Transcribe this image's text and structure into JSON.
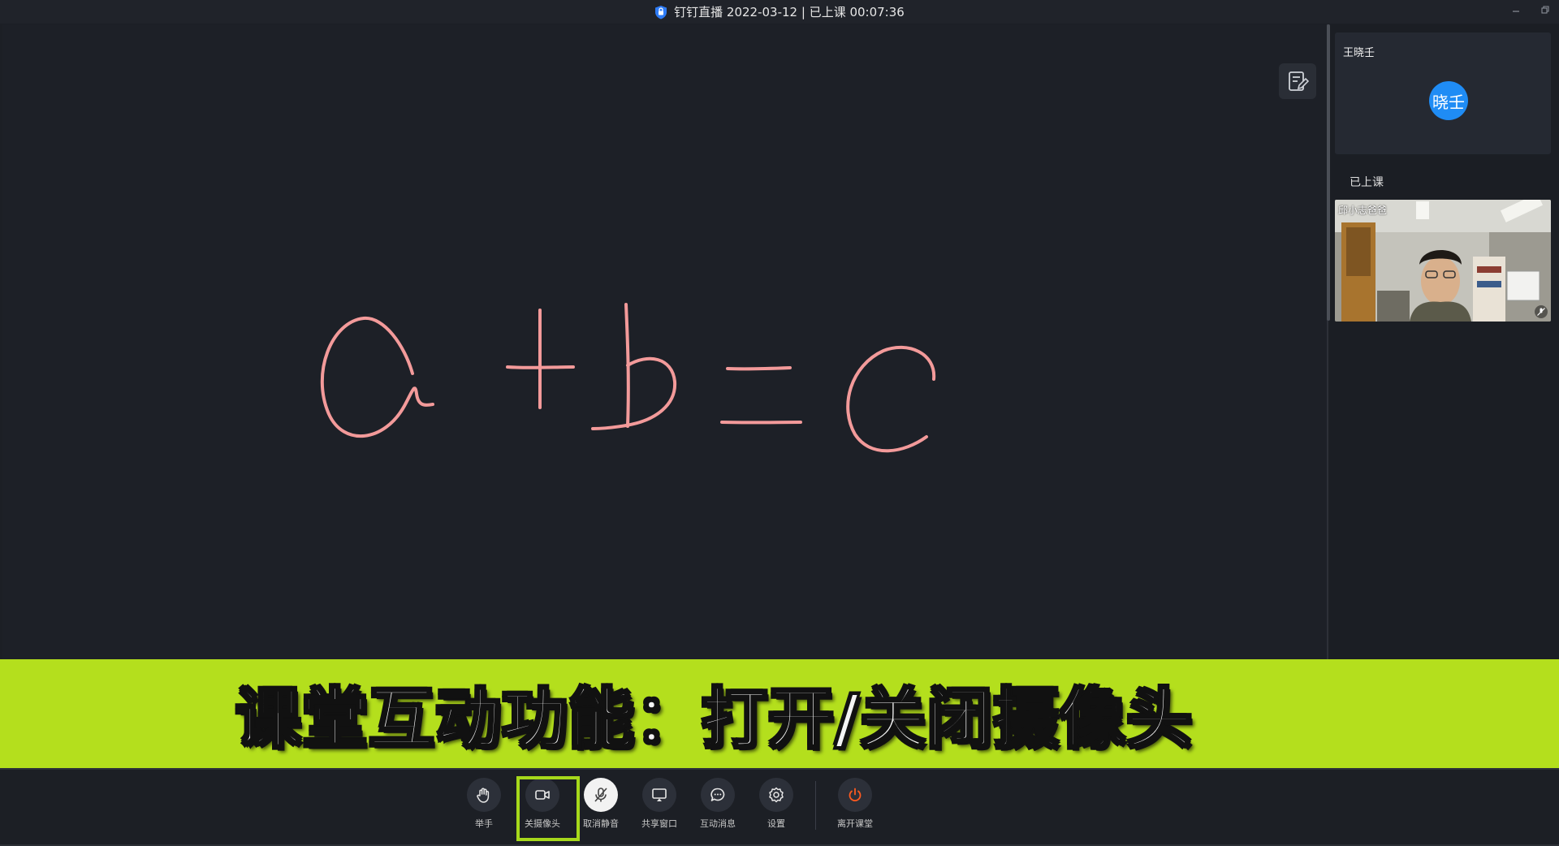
{
  "window": {
    "title": "钉钉直播 2022-03-12 | 已上课 00:07:36"
  },
  "board": {
    "drawing_text": "a + b = c",
    "ink_color": "#f39a9a"
  },
  "panel": {
    "host_name": "王晓壬",
    "host_avatar_text": "晓壬",
    "section_label": "已上课",
    "video_name": "邱小志爸爸"
  },
  "banner": {
    "text": "课堂互动功能：打开/关闭摄像头",
    "color": "#b4df1d"
  },
  "toolbar": {
    "raise_hand": "举手",
    "camera_off": "关摄像头",
    "unmute": "取消静音",
    "share_window": "共享窗口",
    "messages": "互动消息",
    "settings": "设置",
    "leave": "离开课堂"
  },
  "colors": {
    "accent_blue": "#1f8cf5",
    "leave_red": "#ff5a1f",
    "highlight_green": "#a6d81b"
  }
}
